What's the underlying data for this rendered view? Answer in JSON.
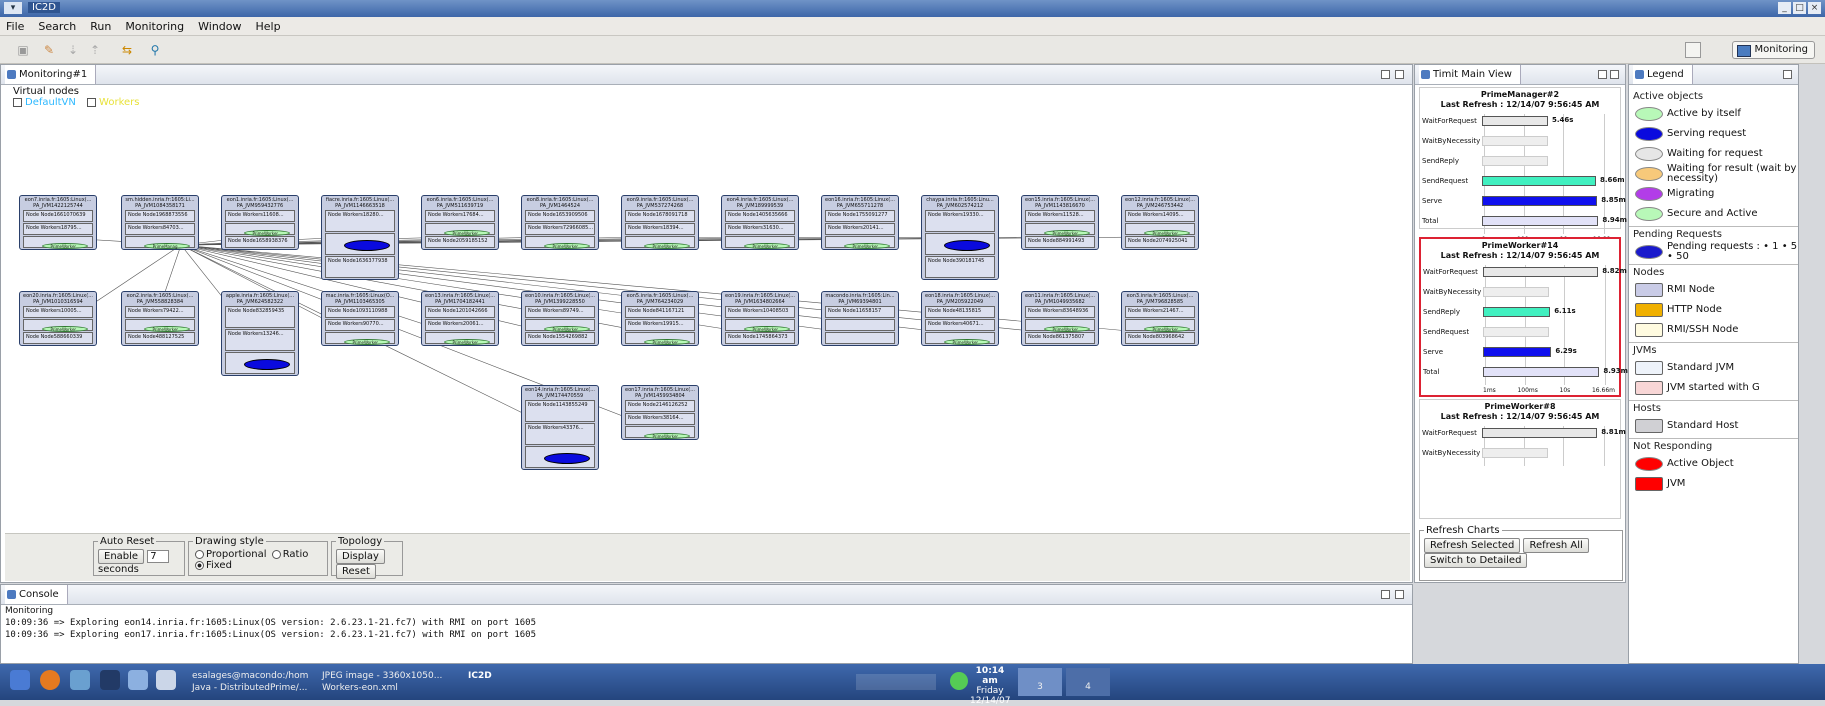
{
  "window": {
    "title": "IC2D"
  },
  "menu": {
    "items": [
      "File",
      "Search",
      "Run",
      "Monitoring",
      "Window",
      "Help"
    ]
  },
  "perspective": {
    "label": "Monitoring"
  },
  "monitoring_tab": {
    "title": "Monitoring#1"
  },
  "virtual_nodes": {
    "label": "Virtual nodes",
    "items": [
      {
        "label": "DefaultVN",
        "color": "#2fb9ff"
      },
      {
        "label": "Workers",
        "color": "#e8e23a"
      }
    ]
  },
  "nodes": [
    {
      "host": "eon7.inria.fr:1605:Linux(...",
      "jvm": "PA_JVM1422125744",
      "items": [
        "Node Node1661070639",
        "Node Workers18795...",
        "PrimeWorker..."
      ],
      "active": "green"
    },
    {
      "host": "sm.hidden.inria.fr:1605:Li...",
      "jvm": "PA_JVM1084358171",
      "items": [
        "Node Node1968873556",
        "Node Workers84703...",
        "PrimeManag..."
      ],
      "active": "green"
    },
    {
      "host": "eon1.inria.fr:1605:Linux(...",
      "jvm": "PA_JVM959432776",
      "items": [
        "Node Workers11608...",
        "PrimeWorker...",
        "Node Node1658938376"
      ],
      "active": "green"
    },
    {
      "host": "fiacre.inria.fr:1605:Linux(...",
      "jvm": "PA_JVM1146663518",
      "items": [
        "Node Workers18280...",
        "",
        "Node Node1636377938"
      ],
      "active": "blue"
    },
    {
      "host": "eon6.inria.fr:1605:Linux(...",
      "jvm": "PA_JVM511639719",
      "items": [
        "Node Workers17684...",
        "PrimeWorker...",
        "Node Node2059185152"
      ],
      "active": "green"
    },
    {
      "host": "eon8.inria.fr:1605:Linux(...",
      "jvm": "PA_JVM1464524",
      "items": [
        "Node Node1653909506",
        "Node Workers72966085...",
        "PrimeWorker..."
      ],
      "active": "green"
    },
    {
      "host": "eon9.inria.fr:1605:Linux(...",
      "jvm": "PA_JVM537274268",
      "items": [
        "Node Node1678091718",
        "Node Workers18394...",
        "PrimeWorker..."
      ],
      "active": "green"
    },
    {
      "host": "eon4.inria.fr:1605:Linux(...",
      "jvm": "PA_JVM189999539",
      "items": [
        "Node Node1405635666",
        "Node Workers31630...",
        "PrimeWorker..."
      ],
      "active": "green"
    },
    {
      "host": "eon16.inria.fr:1605:Linux(...",
      "jvm": "PA_JVM655711278",
      "items": [
        "Node Node1755091277",
        "Node Workers20141...",
        "PrimeWorker..."
      ],
      "active": "green"
    },
    {
      "host": "chaypa.inria.fr:1605:Linu...",
      "jvm": "PA_JVM602574212",
      "items": [
        "Node Workers19330...",
        "",
        "Node Node390181745"
      ],
      "active": "blue"
    },
    {
      "host": "eon15.inria.fr:1605:Linux(...",
      "jvm": "PA_JVM1143816670",
      "items": [
        "Node Workers11528...",
        "PrimeWorker...",
        "Node Node884991493"
      ],
      "active": "green"
    },
    {
      "host": "eon12.inria.fr:1605:Linux(...",
      "jvm": "PA_JVM246753442",
      "items": [
        "Node Workers14095...",
        "PrimeWorker...",
        "Node Node2074925041"
      ],
      "active": "green"
    },
    {
      "host": "eon20.inria.fr:1605:Linux(...",
      "jvm": "PA_JVM1010316594",
      "items": [
        "Node Workers10005...",
        "PrimeWorker...",
        "Node Node588660339"
      ],
      "active": "green"
    },
    {
      "host": "eon2.inria.fr:1605:Linux(...",
      "jvm": "PA_JVM558828384",
      "items": [
        "Node Workers79422...",
        "PrimeWorker...",
        "Node Node488127525"
      ],
      "active": "green"
    },
    {
      "host": "apple.inria.fr:1605:Linux(...",
      "jvm": "PA_JVM624582322",
      "items": [
        "Node Node832859435",
        "Node Workers13246...",
        ""
      ],
      "active": "blue"
    },
    {
      "host": "mac.inria.fr:1605:Linux(O...",
      "jvm": "PA_JVM1103465305",
      "items": [
        "Node Node1093110988",
        "Node Workers90770...",
        "PrimeWorker..."
      ],
      "active": "green"
    },
    {
      "host": "eon13.inria.fr:1605:Linux(...",
      "jvm": "PA_JVM1704182441",
      "items": [
        "Node Node1201042666",
        "Node Workers20061...",
        "PrimeWorker..."
      ],
      "active": "green"
    },
    {
      "host": "eon10.inria.fr:1605:Linux(...",
      "jvm": "PA_JVM1399228550",
      "items": [
        "Node Workers89749...",
        "PrimeWorker...",
        "Node Node1554269882"
      ],
      "active": "green"
    },
    {
      "host": "eon5.inria.fr:1605:Linux(...",
      "jvm": "PA_JVM764234029",
      "items": [
        "Node Node841167121",
        "Node Workers19915...",
        "PrimeWorker..."
      ],
      "active": "green"
    },
    {
      "host": "eon19.inria.fr:1605:Linux(...",
      "jvm": "PA_JVM1634802664",
      "items": [
        "Node Workers10408503",
        "PrimeWorker...",
        "Node Node1745864373"
      ],
      "active": "green"
    },
    {
      "host": "macondo.inria.fr:1605:Lin...",
      "jvm": "PA_JVM69394801",
      "items": [
        "Node Node11658157",
        "",
        ""
      ],
      "active": "none"
    },
    {
      "host": "eon18.inria.fr:1605:Linux(...",
      "jvm": "PA_JVM205922049",
      "items": [
        "Node Node48135815",
        "Node Workers40671...",
        "PrimeWorker..."
      ],
      "active": "green"
    },
    {
      "host": "eon11.inria.fr:1605:Linux(...",
      "jvm": "PA_JVM1049935682",
      "items": [
        "Node Workers83648936",
        "PrimeWorker...",
        "Node Node861375807"
      ],
      "active": "green"
    },
    {
      "host": "eon3.inria.fr:1605:Linux(...",
      "jvm": "PA_JVM796828585",
      "items": [
        "Node Workers21467...",
        "PrimeWorker...",
        "Node Node803968642"
      ],
      "active": "green"
    },
    {
      "host": "eon14.inria.fr:1605:Linux(...",
      "jvm": "PA_JVM174470559",
      "items": [
        "Node Node1143855249",
        "Node Workers43376...",
        ""
      ],
      "active": "blue"
    },
    {
      "host": "eon17.inria.fr:1605:Linux(...",
      "jvm": "PA_JVM1459934804",
      "items": [
        "Node Node2146126252",
        "Node Workers38164...",
        "PrimeWorker..."
      ],
      "active": "green"
    }
  ],
  "controls": {
    "auto_reset": {
      "label": "Auto Reset",
      "enable": "Enable",
      "value": "7",
      "unit": "seconds"
    },
    "drawing": {
      "label": "Drawing style",
      "options": [
        "Proportional",
        "Ratio",
        "Fixed"
      ],
      "selected": "Fixed"
    },
    "topology": {
      "label": "Topology",
      "display": "Display",
      "reset": "Reset"
    }
  },
  "console": {
    "title": "Console",
    "subtitle": "Monitoring",
    "lines": [
      "10:09:36 => Exploring eon14.inria.fr:1605:Linux(OS version: 2.6.23.1-21.fc7) with RMI on port 1605",
      "10:09:36 => Exploring eon17.inria.fr:1605:Linux(OS version: 2.6.23.1-21.fc7) with RMI on port 1605"
    ]
  },
  "timit": {
    "title": "Timit Main View",
    "axis": [
      "1ms",
      "100ms",
      "10s",
      "16.66m"
    ],
    "charts": [
      {
        "name": "PrimeManager#2",
        "refresh": "Last Refresh : 12/14/07 9:56:45 AM",
        "rows": [
          {
            "label": "WaitForRequest",
            "value": "5.46s",
            "frac": 0.55,
            "color": "#e8e8e8"
          },
          {
            "label": "WaitByNecessity",
            "value": "",
            "frac": 0,
            "color": "#e8e8e8"
          },
          {
            "label": "SendReply",
            "value": "",
            "frac": 0,
            "color": "#e8e8e8"
          },
          {
            "label": "SendRequest",
            "value": "8.66m",
            "frac": 0.95,
            "color": "#41f0c0"
          },
          {
            "label": "Serve",
            "value": "8.85m",
            "frac": 0.96,
            "color": "#1010ee"
          },
          {
            "label": "Total",
            "value": "8.94m",
            "frac": 0.97,
            "color": "#e2e2f8"
          }
        ]
      },
      {
        "name": "PrimeWorker#14",
        "refresh": "Last Refresh : 12/14/07 9:56:45 AM",
        "rows": [
          {
            "label": "WaitForRequest",
            "value": "8.82m",
            "frac": 0.96,
            "color": "#e8e8e8"
          },
          {
            "label": "WaitByNecessity",
            "value": "",
            "frac": 0,
            "color": "#e8e8e8"
          },
          {
            "label": "SendReply",
            "value": "6.11s",
            "frac": 0.56,
            "color": "#41f0c0"
          },
          {
            "label": "SendRequest",
            "value": "",
            "frac": 0,
            "color": "#e8e8e8"
          },
          {
            "label": "Serve",
            "value": "6.29s",
            "frac": 0.57,
            "color": "#1010ee"
          },
          {
            "label": "Total",
            "value": "8.93m",
            "frac": 0.97,
            "color": "#e2e2f8"
          }
        ]
      },
      {
        "name": "PrimeWorker#8",
        "refresh": "Last Refresh : 12/14/07 9:56:45 AM",
        "rows": [
          {
            "label": "WaitForRequest",
            "value": "8.81m",
            "frac": 0.96,
            "color": "#e8e8e8"
          },
          {
            "label": "WaitByNecessity",
            "value": "",
            "frac": 0,
            "color": "#e8e8e8"
          }
        ]
      }
    ],
    "refresh_group": "Refresh Charts",
    "buttons": [
      "Refresh Selected",
      "Refresh All",
      "Switch to Detailed"
    ]
  },
  "legend": {
    "title": "Legend",
    "sections": [
      {
        "title": "Active objects",
        "items": [
          {
            "label": "Active by itself",
            "shape": "ellipse",
            "color": "#b8f8b8"
          },
          {
            "label": "Serving request",
            "shape": "ellipse",
            "color": "#0a0ade"
          },
          {
            "label": "Waiting for request",
            "shape": "ellipse",
            "color": "#e6e6e6"
          },
          {
            "label": "Waiting for result (wait by necessity)",
            "shape": "ellipse",
            "color": "#f7c97a"
          },
          {
            "label": "Migrating",
            "shape": "ellipse",
            "color": "#b23de8"
          },
          {
            "label": "Secure and Active",
            "shape": "ellipse",
            "color": "#b8f8b8"
          }
        ]
      },
      {
        "title": "Pending Requests",
        "items": [
          {
            "label": "Pending requests : • 1 • 5 • 50",
            "shape": "ellipse",
            "color": "#1a1acc"
          }
        ]
      },
      {
        "title": "Nodes",
        "items": [
          {
            "label": "RMI Node",
            "shape": "square",
            "color": "#c9cbe6"
          },
          {
            "label": "HTTP Node",
            "shape": "square",
            "color": "#f0b000"
          },
          {
            "label": "RMI/SSH Node",
            "shape": "square",
            "color": "#fffbe0"
          }
        ]
      },
      {
        "title": "JVMs",
        "items": [
          {
            "label": "Standard JVM",
            "shape": "square",
            "color": "#eef3fa"
          },
          {
            "label": "JVM started with G",
            "shape": "square",
            "color": "#f8d6d6"
          }
        ]
      },
      {
        "title": "Hosts",
        "items": [
          {
            "label": "Standard Host",
            "shape": "square",
            "color": "#d0d0d4"
          }
        ]
      },
      {
        "title": "Not Responding",
        "items": [
          {
            "label": "Active Object",
            "shape": "ellipse",
            "color": "#ff0000"
          },
          {
            "label": "JVM",
            "shape": "square",
            "color": "#ff0000"
          }
        ]
      }
    ]
  },
  "taskbar": {
    "tasks": [
      "esalages@macondo:/hom",
      "Java - DistributedPrime/...",
      "JPEG image - 3360x1050...",
      "Workers-eon.xml",
      "IC2D"
    ],
    "clock": {
      "time": "10:14 am",
      "day": "Friday",
      "date": "12/14/07"
    },
    "desktops": [
      "3",
      "4"
    ]
  }
}
